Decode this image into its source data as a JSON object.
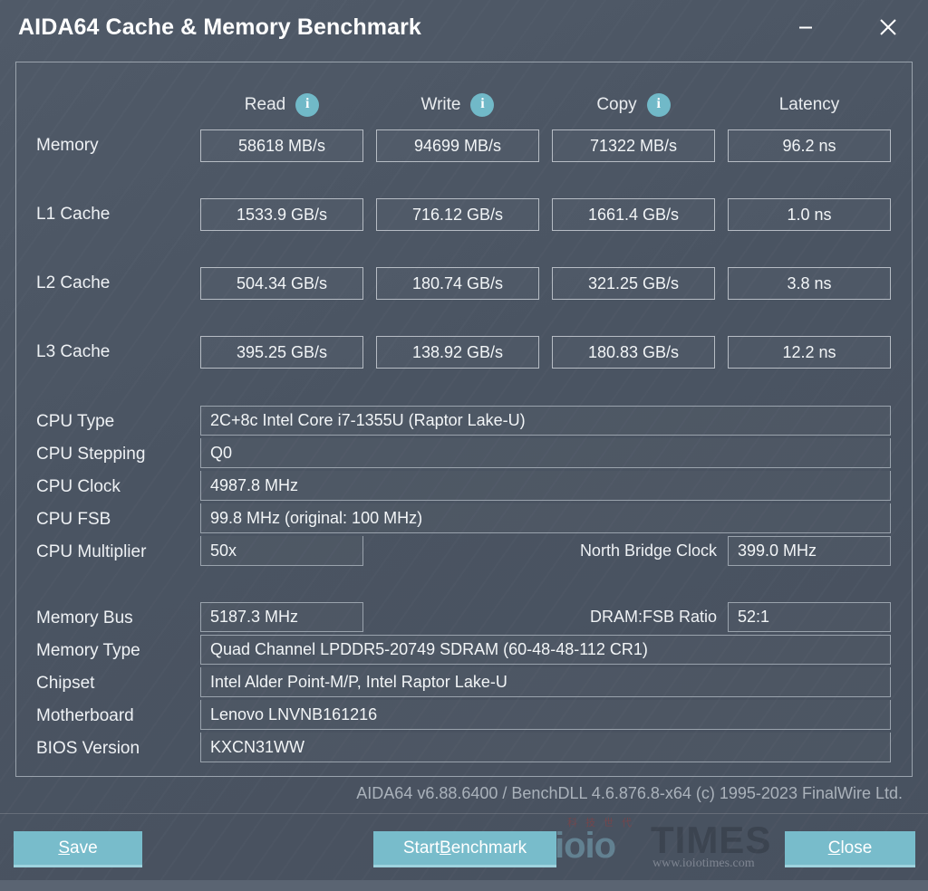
{
  "window": {
    "title": "AIDA64 Cache & Memory Benchmark",
    "minimize_label": "minimize",
    "close_label": "close"
  },
  "benchmark": {
    "columns": [
      "Read",
      "Write",
      "Copy",
      "Latency"
    ],
    "info_icon_label": "i",
    "rows": [
      {
        "label": "Memory",
        "read": "58618 MB/s",
        "write": "94699 MB/s",
        "copy": "71322 MB/s",
        "latency": "96.2 ns"
      },
      {
        "label": "L1 Cache",
        "read": "1533.9 GB/s",
        "write": "716.12 GB/s",
        "copy": "1661.4 GB/s",
        "latency": "1.0 ns"
      },
      {
        "label": "L2 Cache",
        "read": "504.34 GB/s",
        "write": "180.74 GB/s",
        "copy": "321.25 GB/s",
        "latency": "3.8 ns"
      },
      {
        "label": "L3 Cache",
        "read": "395.25 GB/s",
        "write": "138.92 GB/s",
        "copy": "180.83 GB/s",
        "latency": "12.2 ns"
      }
    ]
  },
  "cpu_info": {
    "type_label": "CPU Type",
    "type_value": "2C+8c Intel Core i7-1355U  (Raptor Lake-U)",
    "stepping_label": "CPU Stepping",
    "stepping_value": "Q0",
    "clock_label": "CPU Clock",
    "clock_value": "4987.8 MHz",
    "fsb_label": "CPU FSB",
    "fsb_value": "99.8 MHz  (original: 100 MHz)",
    "multiplier_label": "CPU Multiplier",
    "multiplier_value": "50x",
    "north_bridge_label": "North Bridge Clock",
    "north_bridge_value": "399.0 MHz"
  },
  "system_info": {
    "memory_bus_label": "Memory Bus",
    "memory_bus_value": "5187.3 MHz",
    "dram_fsb_label": "DRAM:FSB Ratio",
    "dram_fsb_value": "52:1",
    "memory_type_label": "Memory Type",
    "memory_type_value": "Quad Channel LPDDR5-20749 SDRAM  (60-48-48-112 CR1)",
    "chipset_label": "Chipset",
    "chipset_value": "Intel Alder Point-M/P, Intel Raptor Lake-U",
    "motherboard_label": "Motherboard",
    "motherboard_value": "Lenovo LNVNB161216",
    "bios_label": "BIOS Version",
    "bios_value": "KXCN31WW"
  },
  "footer": {
    "copyright": "AIDA64 v6.88.6400 / BenchDLL 4.6.876.8-x64  (c) 1995-2023 FinalWire Ltd."
  },
  "watermark": {
    "brand": "ioio",
    "times": "TIMES",
    "cn": "科技世代",
    "url": "www.ioiotimes.com"
  },
  "buttons": {
    "save": {
      "pre": "",
      "accel": "S",
      "post": "ave"
    },
    "start": {
      "pre": "Start ",
      "accel": "B",
      "post": "enchmark"
    },
    "close": {
      "pre": "",
      "accel": "C",
      "post": "lose"
    }
  },
  "colors": {
    "accent": "#78bccb",
    "accent_light": "#9ed3de",
    "background": "#4b5563",
    "info_icon": "#71b9c8",
    "text": "#f2f5f7"
  }
}
